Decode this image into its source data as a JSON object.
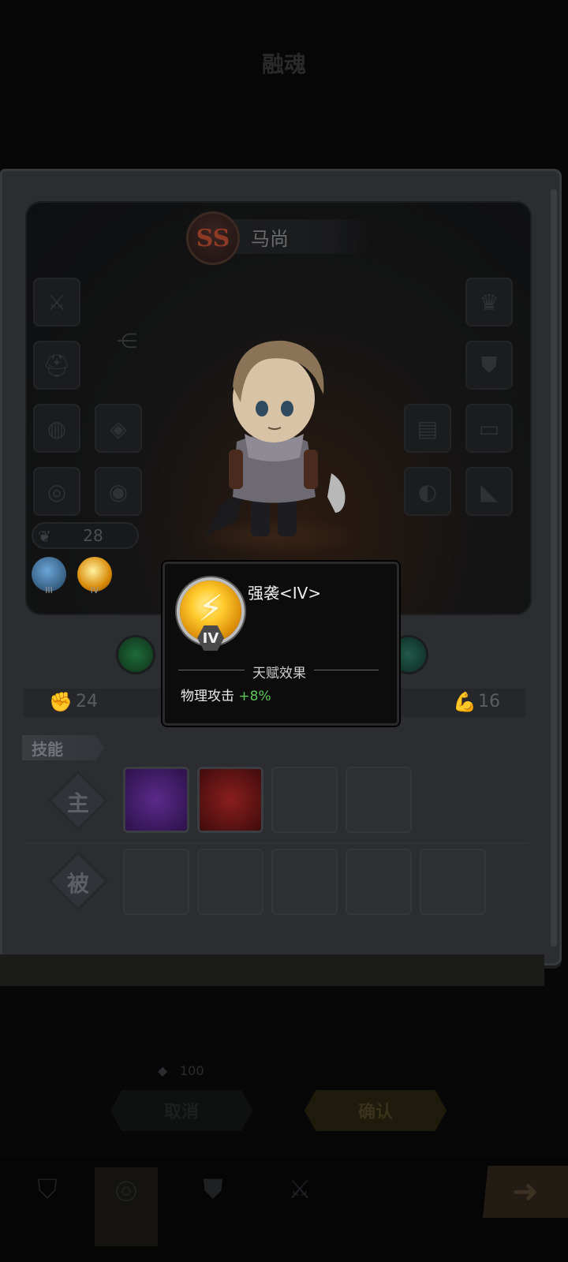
{
  "page": {
    "title": "融魂"
  },
  "hero": {
    "rank": "SS",
    "name": "马尚",
    "power": "28"
  },
  "talents": [
    {
      "level": "III",
      "icon": "ice-blade-talent-icon"
    },
    {
      "level": "IV",
      "icon": "lightning-talent-icon"
    }
  ],
  "attributes": [
    {
      "icon": "fist-icon",
      "value": "24"
    },
    {
      "icon": "muscle-arm-icon",
      "value": "16"
    }
  ],
  "skills": {
    "tab_label": "技能",
    "active_label": "主",
    "passive_label": "被"
  },
  "tooltip": {
    "title": "强袭<IV>",
    "level": "IV",
    "section": "天赋效果",
    "effect_label": "物理攻击",
    "effect_value": "+8%"
  },
  "cost": {
    "icon": "diamond-icon",
    "value": "100"
  },
  "buttons": {
    "left_label": "取消",
    "confirm_label": "确认"
  },
  "colors": {
    "accent_green": "#5fc85a",
    "gold": "#ffcb2c",
    "background": "#070707"
  }
}
